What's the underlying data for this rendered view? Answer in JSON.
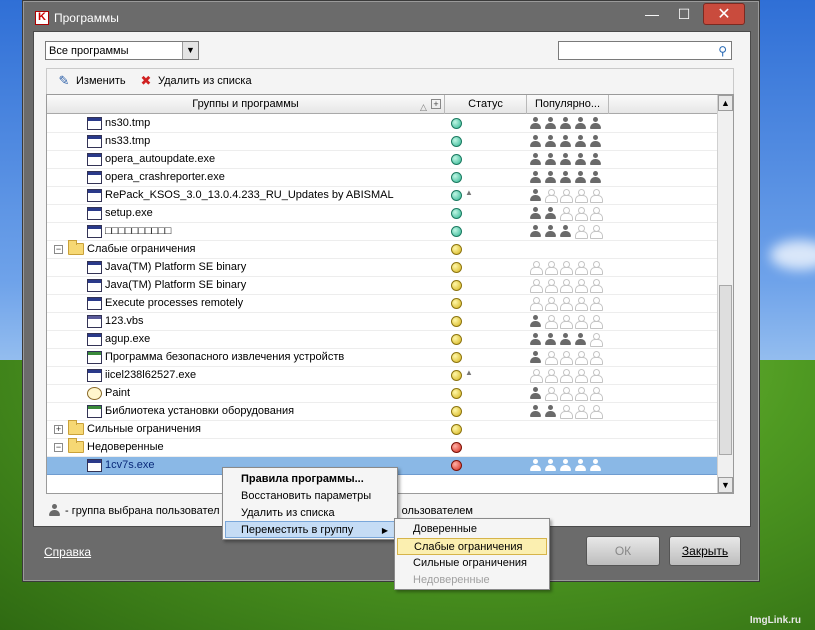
{
  "window": {
    "title": "Программы"
  },
  "filter": {
    "value": "Все программы",
    "search_placeholder": ""
  },
  "toolbar": {
    "edit_label": "Изменить",
    "remove_label": "Удалить из списка"
  },
  "grid": {
    "columns": {
      "name": "Группы и программы",
      "status": "Статус",
      "popularity": "Популярно..."
    },
    "rows": [
      {
        "kind": "app",
        "name": "ns30.tmp",
        "status": "green",
        "pop": [
          1,
          1,
          1,
          1,
          1
        ]
      },
      {
        "kind": "app",
        "name": "ns33.tmp",
        "status": "green",
        "pop": [
          1,
          1,
          1,
          1,
          1
        ]
      },
      {
        "kind": "app",
        "name": "opera_autoupdate.exe",
        "status": "green",
        "pop": [
          1,
          1,
          1,
          1,
          1
        ]
      },
      {
        "kind": "app",
        "name": "opera_crashreporter.exe",
        "status": "green",
        "pop": [
          1,
          1,
          1,
          1,
          1
        ]
      },
      {
        "kind": "app",
        "name": "RePack_KSOS_3.0_13.0.4.233_RU_Updates by ABISMAL",
        "status": "green",
        "pop": [
          1,
          0,
          0,
          0,
          0
        ],
        "extra": true
      },
      {
        "kind": "app",
        "name": "setup.exe",
        "status": "green",
        "pop": [
          1,
          1,
          0,
          0,
          0
        ]
      },
      {
        "kind": "app",
        "name": "□□□□□□□□□□",
        "status": "green",
        "pop": [
          1,
          1,
          1,
          0,
          0
        ]
      },
      {
        "kind": "group",
        "name": "Слабые ограничения",
        "status": "yellow",
        "pop": null,
        "expanded": true
      },
      {
        "kind": "app",
        "name": "Java(TM) Platform SE binary",
        "status": "yellow",
        "pop": [
          0,
          0,
          0,
          0,
          0
        ]
      },
      {
        "kind": "app",
        "name": "Java(TM) Platform SE binary",
        "status": "yellow",
        "pop": [
          0,
          0,
          0,
          0,
          0
        ]
      },
      {
        "kind": "app",
        "name": "Execute processes remotely",
        "status": "yellow",
        "pop": [
          0,
          0,
          0,
          0,
          0
        ]
      },
      {
        "kind": "app",
        "name": "123.vbs",
        "status": "yellow",
        "pop": [
          1,
          0,
          0,
          0,
          0
        ],
        "icon": "script"
      },
      {
        "kind": "app",
        "name": "agup.exe",
        "status": "yellow",
        "pop": [
          1,
          1,
          1,
          1,
          0
        ]
      },
      {
        "kind": "app",
        "name": "Программа безопасного извлечения устройств",
        "status": "yellow",
        "pop": [
          1,
          0,
          0,
          0,
          0
        ],
        "icon": "green"
      },
      {
        "kind": "app",
        "name": "iicel238l62527.exe",
        "status": "yellow",
        "pop": [
          0,
          0,
          0,
          0,
          0
        ],
        "extra": true
      },
      {
        "kind": "app",
        "name": "Paint",
        "status": "yellow",
        "pop": [
          1,
          0,
          0,
          0,
          0
        ],
        "icon": "paint"
      },
      {
        "kind": "app",
        "name": "Библиотека установки оборудования",
        "status": "yellow",
        "pop": [
          1,
          1,
          0,
          0,
          0
        ],
        "icon": "green"
      },
      {
        "kind": "group",
        "name": "Сильные ограничения",
        "status": "yellow",
        "pop": null,
        "expanded": false
      },
      {
        "kind": "group",
        "name": "Недоверенные",
        "status": "red",
        "pop": null,
        "expanded": true
      },
      {
        "kind": "app",
        "name": "1cv7s.exe",
        "status": "red",
        "pop": [
          1,
          1,
          1,
          1,
          1
        ],
        "selected": true
      }
    ]
  },
  "legend": {
    "text_left": "- группа выбрана пользовател",
    "text_right": "ользователем"
  },
  "footer": {
    "help_label": "Справка",
    "ok_label": "ОК",
    "close_label": "Закрыть"
  },
  "context_menu": {
    "items": [
      "Правила программы...",
      "Восстановить параметры",
      "Удалить из списка",
      "Переместить в группу"
    ]
  },
  "submenu": {
    "items": [
      "Доверенные",
      "Слабые ограничения",
      "Сильные ограничения",
      "Недоверенные"
    ]
  },
  "watermark": "ImgLink.ru",
  "colors": {
    "status_green": "#2fb592",
    "status_yellow": "#d6b41b",
    "status_red": "#d42a1a",
    "selection": "#8ab8e6"
  }
}
